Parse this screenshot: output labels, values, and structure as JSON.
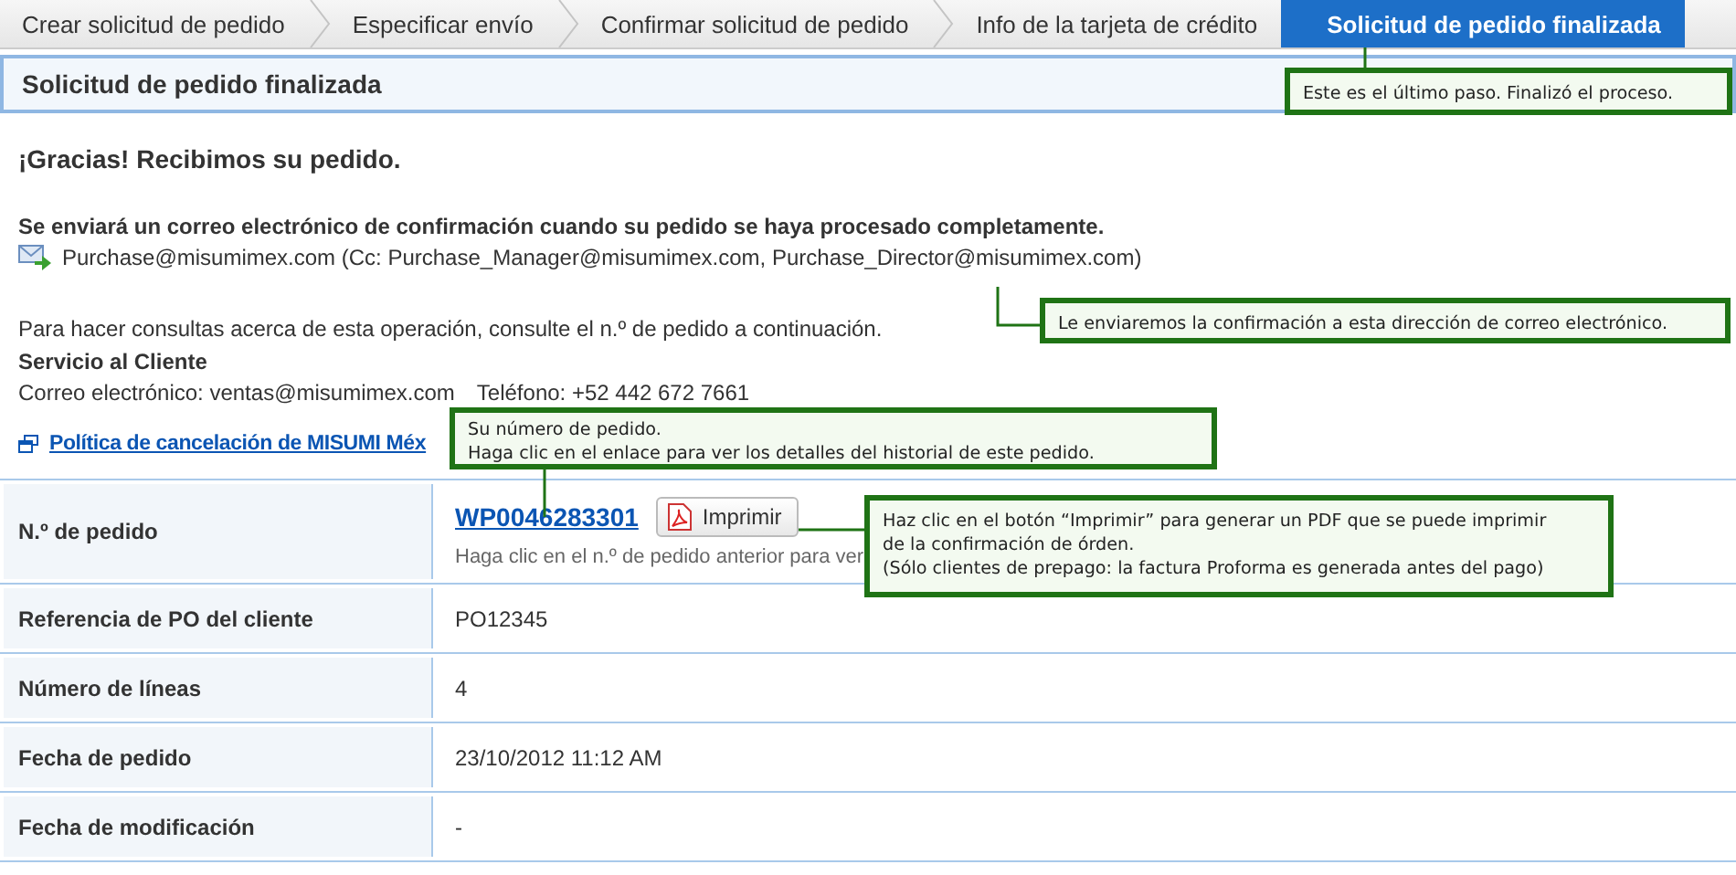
{
  "steps": [
    {
      "label": "Crear solicitud de pedido",
      "selected": false
    },
    {
      "label": "Especificar envío",
      "selected": false
    },
    {
      "label": "Confirmar solicitud de pedido",
      "selected": false
    },
    {
      "label": "Info de la tarjeta de crédito",
      "selected": false
    },
    {
      "label": "Solicitud de pedido finalizada",
      "selected": true
    }
  ],
  "panel_title": "Solicitud de pedido finalizada",
  "thanks": "¡Gracias! Recibimos su pedido.",
  "email_notice": "Se enviará un correo electrónico de confirmación cuando su pedido se haya procesado completamente.",
  "email_recipients": "Purchase@misumimex.com (Cc: Purchase_Manager@misumimex.com, Purchase_Director@misumimex.com)",
  "inquiry": "Para hacer consultas acerca de esta operación, consulte el n.º de pedido a continuación.",
  "service_title": "Servicio al Cliente",
  "service_email": "Correo electrónico: ventas@misumimex.com",
  "service_phone": "Teléfono: +52 442 672 7661",
  "cancel_link": "Política de cancelación de MISUMI Méx",
  "order_table": {
    "rows": [
      {
        "kind": "order",
        "label": "N.º de pedido",
        "value": "WP0046283301",
        "button": "Imprimir",
        "hint": "Haga clic en el n.º de pedido anterior para ver"
      },
      {
        "kind": "text",
        "label": "Referencia de PO del cliente",
        "value": "PO12345"
      },
      {
        "kind": "text",
        "label": "Número de líneas",
        "value": "4"
      },
      {
        "kind": "text",
        "label": "Fecha de pedido",
        "value": "23/10/2012 11:12 AM"
      },
      {
        "kind": "text",
        "label": "Fecha de modificación",
        "value": "-"
      }
    ]
  },
  "callouts": [
    {
      "lines": [
        "Este es el último paso. Finalizó el proceso."
      ]
    },
    {
      "lines": [
        "Le enviaremos la confirmación a esta dirección de correo electrónico."
      ]
    },
    {
      "lines": [
        "Su número de pedido.",
        "Haga clic en el enlace para ver los detalles del historial de este pedido."
      ]
    },
    {
      "lines": [
        "Haz clic en el botón “Imprimir” para generar un PDF que se puede imprimir",
        "de la confirmación de órden.",
        "(Sólo clientes de prepago: la factura Proforma es generada antes del pago)"
      ]
    }
  ]
}
